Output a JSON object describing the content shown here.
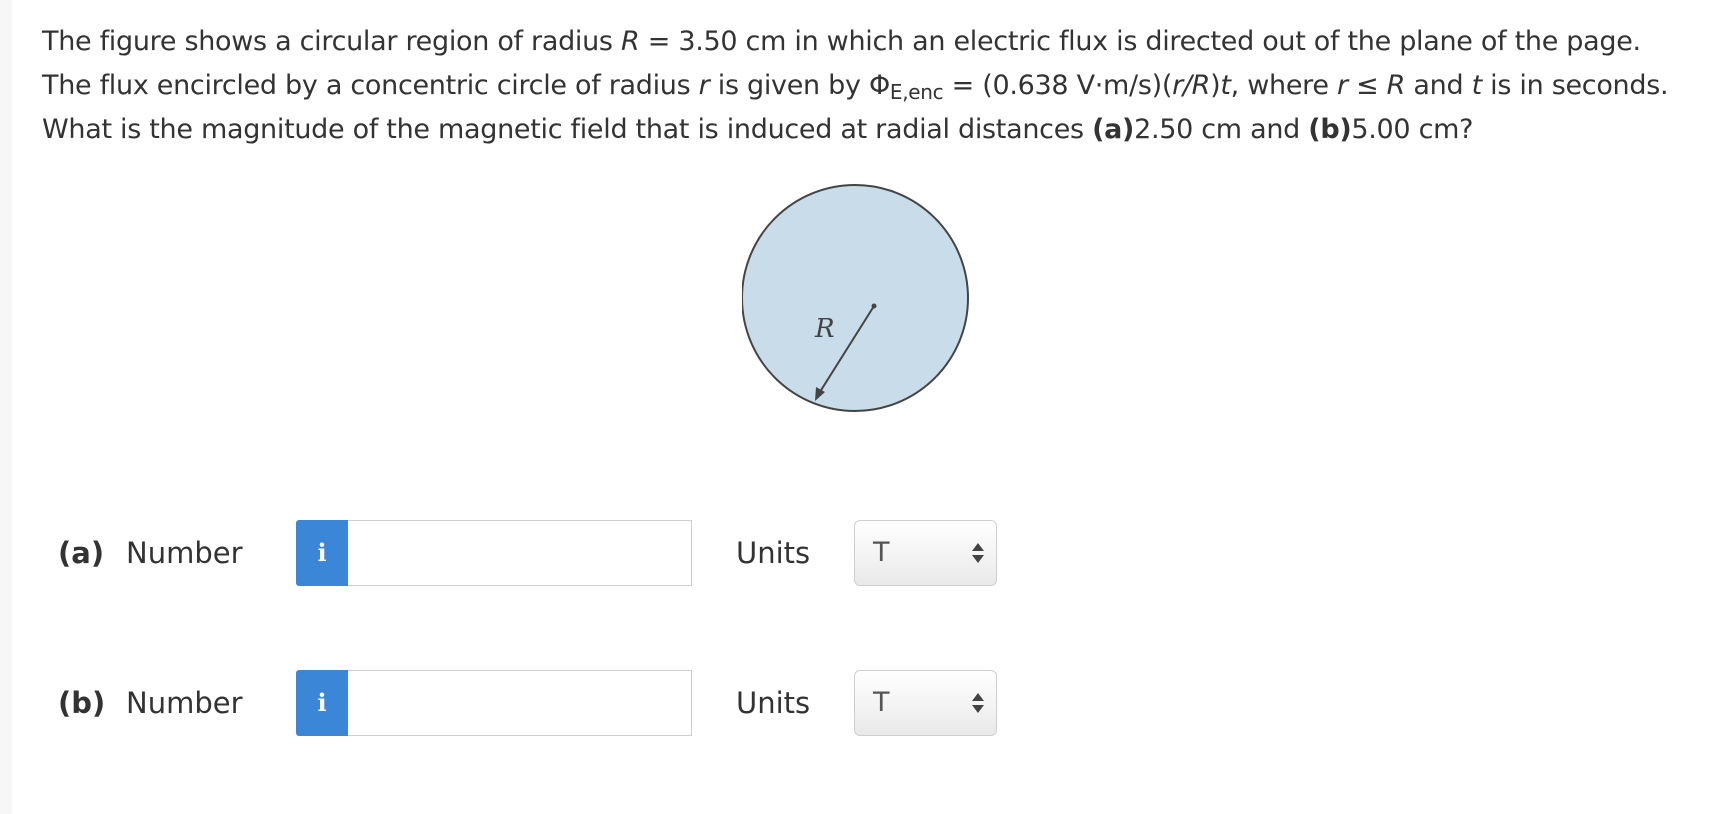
{
  "question": {
    "line1": {
      "a": "The figure shows a circular region of radius ",
      "var_R": "R",
      "b": " = 3.50 cm in which an electric flux is directed out of the plane of the page."
    },
    "line2": {
      "a": "The flux encircled by a concentric circle of radius ",
      "var_r": "r",
      "b": " is given by Φ",
      "sub": "E,enc",
      "c": " = (0.638 V·m/s)(",
      "var_rR": "r/R",
      "d": ")",
      "var_t": "t",
      "e": ", where ",
      "var_r2": "r",
      "f": " ≤ ",
      "var_R2": "R",
      "g": " and ",
      "var_t2": "t",
      "h": " is in seconds."
    },
    "line3": {
      "a": "What is the magnitude of the magnetic field that is induced at radial distances ",
      "part_a": "(a)",
      "b": "2.50 cm and ",
      "part_b": "(b)",
      "c": "5.00 cm?"
    }
  },
  "figure": {
    "radius_label": "R",
    "fill_color": "#c9dcea",
    "stroke_color": "#444444"
  },
  "answers": [
    {
      "part": "(a)",
      "number_label": "Number",
      "info_icon": "i",
      "value": "",
      "units_label": "Units",
      "units_selected": "T"
    },
    {
      "part": "(b)",
      "number_label": "Number",
      "info_icon": "i",
      "value": "",
      "units_label": "Units",
      "units_selected": "T"
    }
  ],
  "colors": {
    "info_button": "#3b86d6",
    "text": "#333333"
  }
}
